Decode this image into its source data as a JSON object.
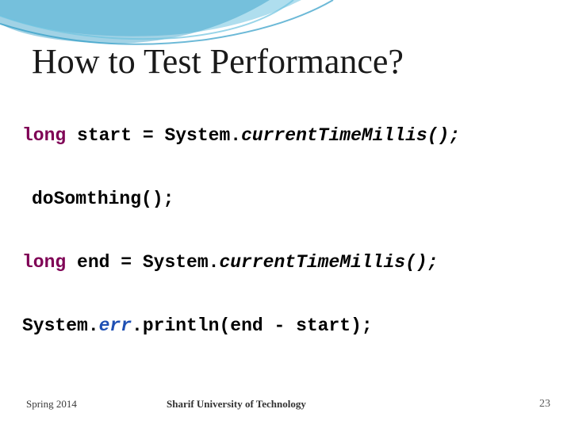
{
  "title": "How to Test Performance?",
  "code": {
    "line1": {
      "kw": "long",
      "var": " start = System.",
      "call": "currentTimeMillis();"
    },
    "line2": {
      "text": "doSomthing();"
    },
    "line3": {
      "kw": "long",
      "var": " end = System.",
      "call": "currentTimeMillis();"
    },
    "line4": {
      "sys": "System.",
      "err": "err",
      "rest": ".println(end - start);"
    }
  },
  "footer": {
    "left": "Spring 2014",
    "center": "Sharif University of Technology",
    "right": "23"
  }
}
